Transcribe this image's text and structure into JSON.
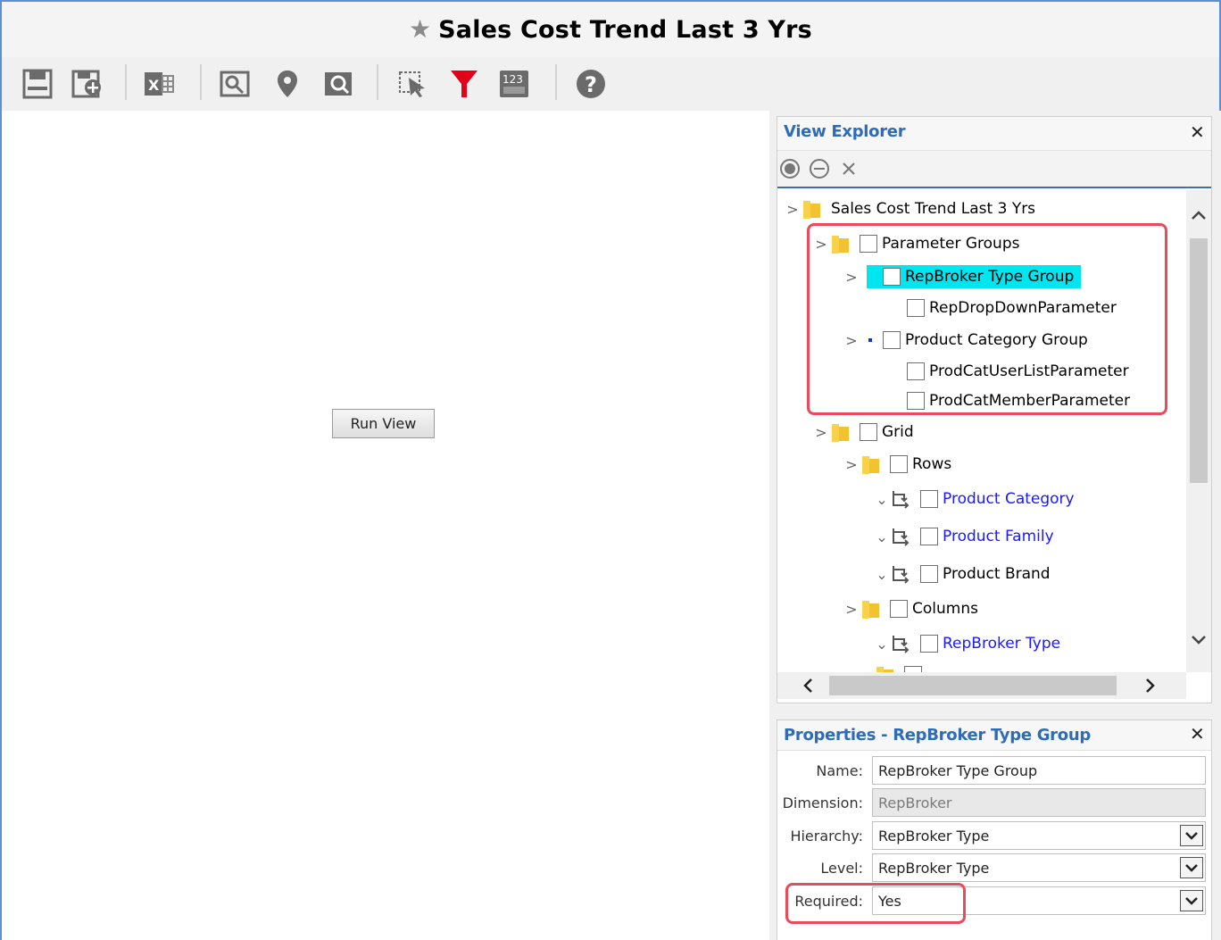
{
  "window": {
    "title": "Sales Cost Trend Last 3 Yrs"
  },
  "toolbar": {
    "icons": [
      "save-icon",
      "save-as-icon",
      "export-excel-icon",
      "zoom-icon",
      "location-pin-icon",
      "preview-icon",
      "select-cursor-icon",
      "filter-icon",
      "numeric-format-icon",
      "help-icon"
    ],
    "colors": {
      "filter": "#e3001b"
    }
  },
  "main": {
    "run_button_label": "Run View"
  },
  "view_explorer": {
    "title": "View Explorer",
    "tree": {
      "root": "Sales Cost Trend Last 3 Yrs",
      "parameter_groups": "Parameter Groups",
      "repbroker_group": "RepBroker Type Group",
      "rep_dropdown_param": "RepDropDownParameter",
      "product_category_group": "Product Category Group",
      "prodcat_userlist_param": "ProdCatUserListParameter",
      "prodcat_member_param": "ProdCatMemberParameter",
      "grid": "Grid",
      "rows": "Rows",
      "product_category": "Product Category",
      "product_family": "Product Family",
      "product_brand": "Product Brand",
      "columns": "Columns",
      "repbroker_type": "RepBroker Type"
    }
  },
  "properties": {
    "title": "Properties - RepBroker Type Group",
    "fields": {
      "name_label": "Name:",
      "name_value": "RepBroker Type Group",
      "dimension_label": "Dimension:",
      "dimension_value": "RepBroker",
      "hierarchy_label": "Hierarchy:",
      "hierarchy_value": "RepBroker Type",
      "level_label": "Level:",
      "level_value": "RepBroker Type",
      "required_label": "Required:",
      "required_value": "Yes"
    }
  },
  "accent_colors": {
    "highlight": "#00e6f0",
    "callout": "#ea4b5a",
    "header_text": "#2e6cb8",
    "link_text": "#1a1aff"
  }
}
